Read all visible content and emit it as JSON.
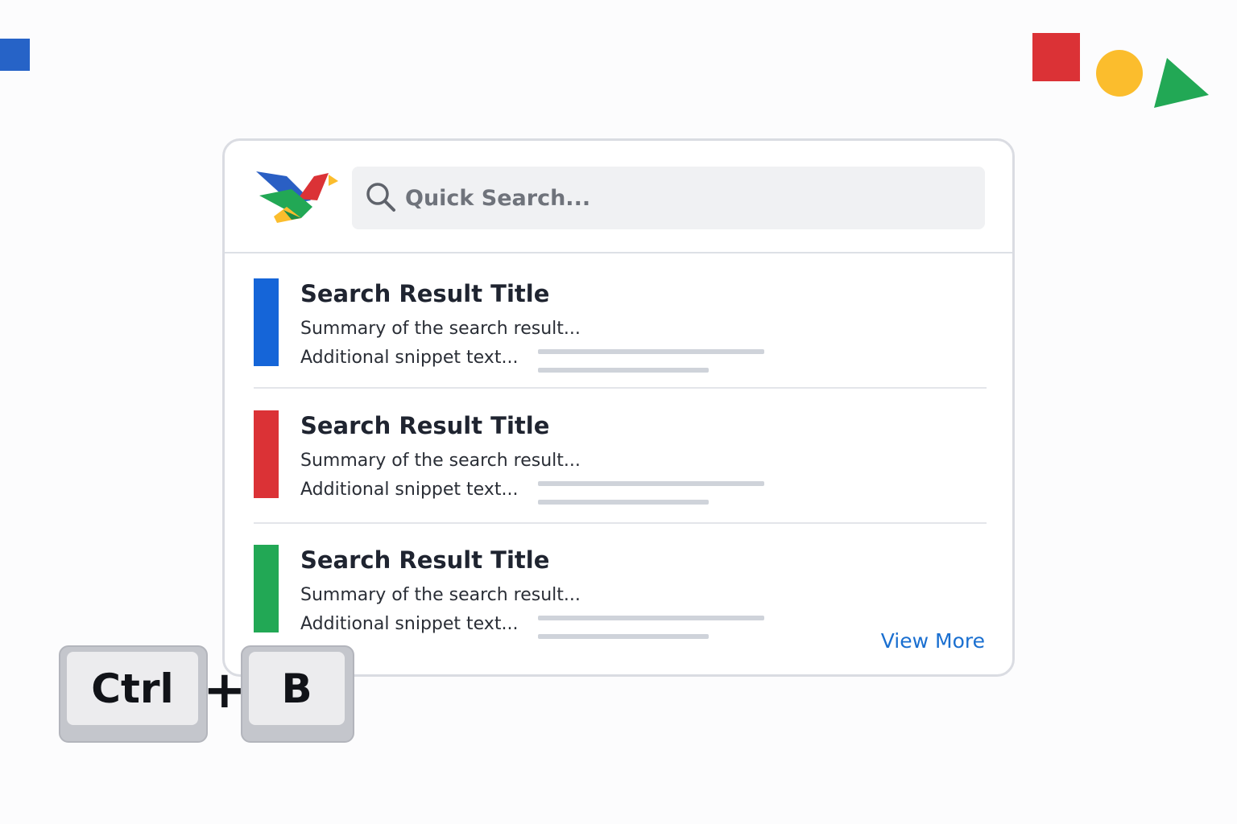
{
  "colors": {
    "blue": "#1565d8",
    "red": "#db3236",
    "yellow": "#fbbd2d",
    "green": "#22a855",
    "link": "#1a6fd0"
  },
  "decorations": [
    {
      "shape": "square",
      "color": "#2663c7"
    },
    {
      "shape": "square",
      "color": "#db3236"
    },
    {
      "shape": "circle",
      "color": "#fbbd2d"
    },
    {
      "shape": "triangle",
      "color": "#22a855"
    }
  ],
  "search": {
    "placeholder": "Quick Search...",
    "icon": "search-icon"
  },
  "logo": {
    "icon": "bird-logo-icon"
  },
  "results": [
    {
      "title": "Search Result Title",
      "summary": "Summary of the search result...",
      "snippet": "Additional snippet text...",
      "accent": "#1565d8"
    },
    {
      "title": "Search Result Title",
      "summary": "Summary of the search result...",
      "snippet": "Additional snippet text...",
      "accent": "#db3236"
    },
    {
      "title": "Search Result Title",
      "summary": "Summary of the search result...",
      "snippet": "Additional snippet text...",
      "accent": "#22a855"
    }
  ],
  "view_more_label": "View More",
  "shortcut": {
    "key1": "Ctrl",
    "separator": "+",
    "key2": "B"
  }
}
